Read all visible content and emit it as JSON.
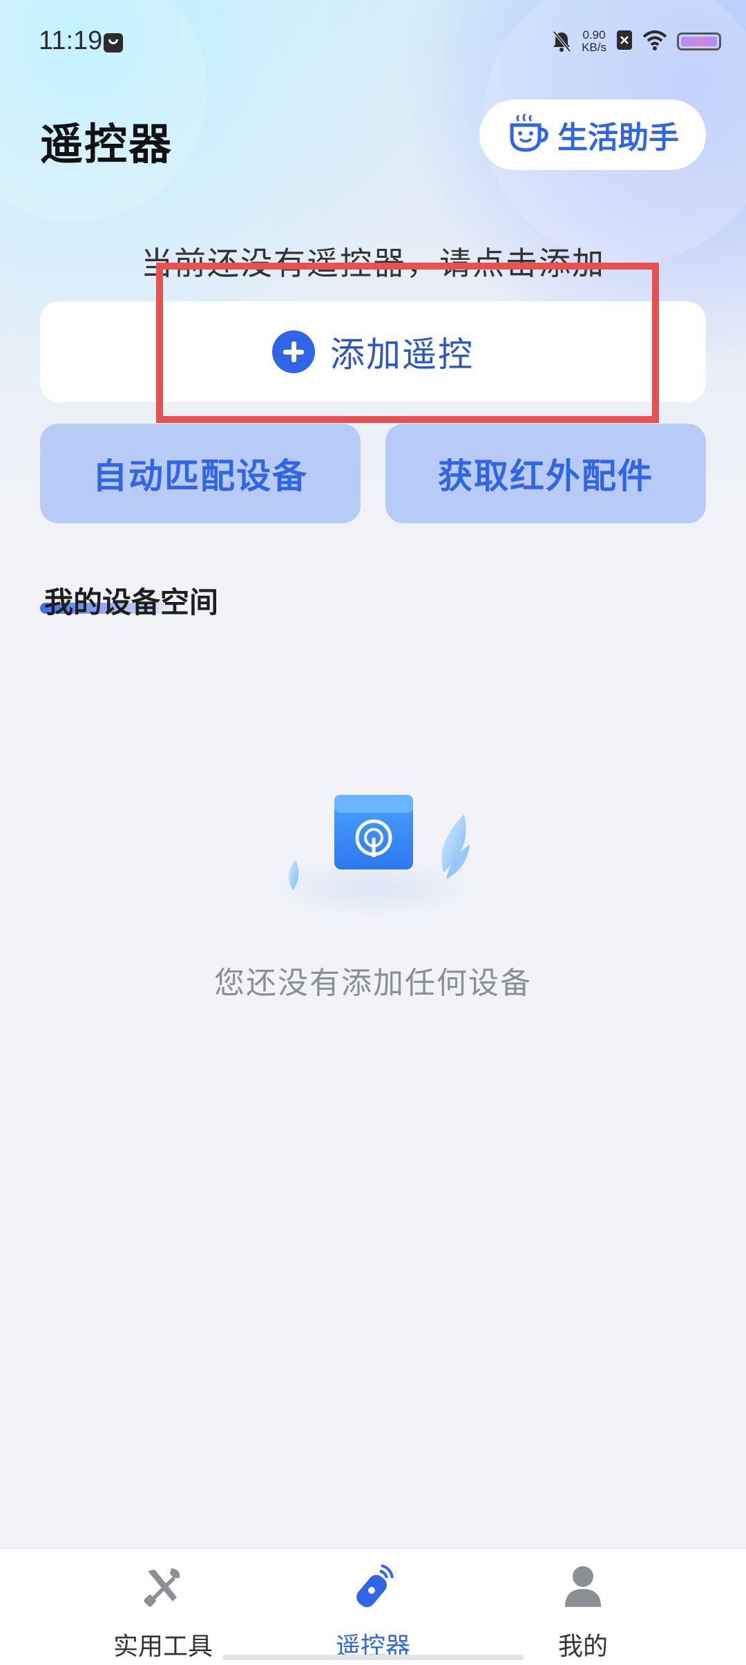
{
  "status_bar": {
    "time": "11:19",
    "net_speed_value": "0.90",
    "net_speed_unit": "KB/s",
    "icons": [
      "message-icon",
      "bell-off-icon",
      "sim-off-icon",
      "wifi-icon",
      "battery-icon"
    ]
  },
  "header": {
    "title": "遥控器",
    "life_assistant_label": "生活助手"
  },
  "main": {
    "hint": "当前还没有遥控器，请点击添加",
    "add_remote_label": "添加遥控",
    "auto_match_label": "自动匹配设备",
    "ir_accessory_label": "获取红外配件",
    "section_title": "我的设备空间",
    "empty_text": "您还没有添加任何设备"
  },
  "bottom_nav": {
    "items": [
      {
        "label": "实用工具",
        "icon": "tools-icon",
        "active": false
      },
      {
        "label": "遥控器",
        "icon": "remote-icon",
        "active": true
      },
      {
        "label": "我的",
        "icon": "person-icon",
        "active": false
      }
    ]
  },
  "colors": {
    "accent": "#2f66e8",
    "secondary_button_bg": "#b8cbf7",
    "highlight_box": "#e95050",
    "page_bg": "#f2f3f6"
  }
}
